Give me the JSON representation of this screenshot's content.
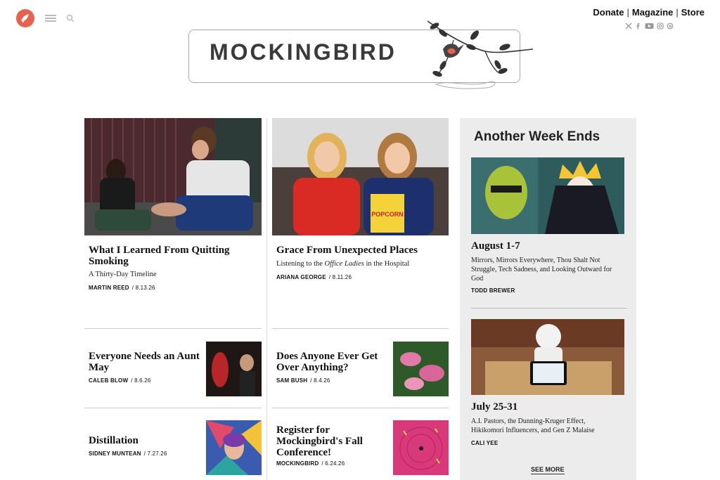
{
  "topbar": {
    "links": [
      "Donate",
      "Magazine",
      "Store"
    ],
    "social_icons": [
      "x-icon",
      "facebook-icon",
      "youtube-icon",
      "instagram-icon",
      "threads-icon"
    ]
  },
  "masthead": {
    "title": "MOCKINGBIRD"
  },
  "col1": {
    "feature": {
      "title": "What I Learned From Quitting Smoking",
      "subtitle": "A Thirty-Day Timeline",
      "author": "MARTIN REED",
      "date": "/ 8.13.26"
    },
    "items": [
      {
        "title": "Everyone Needs an Aunt May",
        "author": "CALEB BLOW",
        "date": "/ 8.6.26"
      },
      {
        "title": "Distillation",
        "author": "SIDNEY MUNTEAN",
        "date": "/ 7.27.26"
      }
    ]
  },
  "col2": {
    "feature": {
      "title": "Grace From Unexpected Places",
      "subtitle_pre": "Listening to the ",
      "subtitle_em": "Office Ladies",
      "subtitle_post": " in the Hospital",
      "author": "ARIANA GEORGE",
      "date": "/ 8.11.26"
    },
    "items": [
      {
        "title": "Does Anyone Ever Get Over Anything?",
        "author": "SAM BUSH",
        "date": "/ 8.4.26"
      },
      {
        "title": "Register for Mockingbird's Fall Conference!",
        "author": "MOCKINGBIRD",
        "date": "/ 6.24.26"
      }
    ],
    "popcorn_label": "POPCORN"
  },
  "sidebar": {
    "heading": "Another Week Ends",
    "entries": [
      {
        "title": "August 1-7",
        "desc": "Mirrors, Mirrors Everywhere, Thou Shalt Not Struggle, Tech Sadness, and Looking Outward for God",
        "author": "TODD BREWER"
      },
      {
        "title": "July 25-31",
        "desc": "A.I. Pastors, the Dunning-Kruger Effect, Hikikomori Influencers, and Gen Z Malaise",
        "author": "CALI YEE"
      }
    ],
    "see_more": "SEE MORE"
  },
  "colors": {
    "brand_red": "#e8614f",
    "sidebar_bg": "#ececec"
  }
}
